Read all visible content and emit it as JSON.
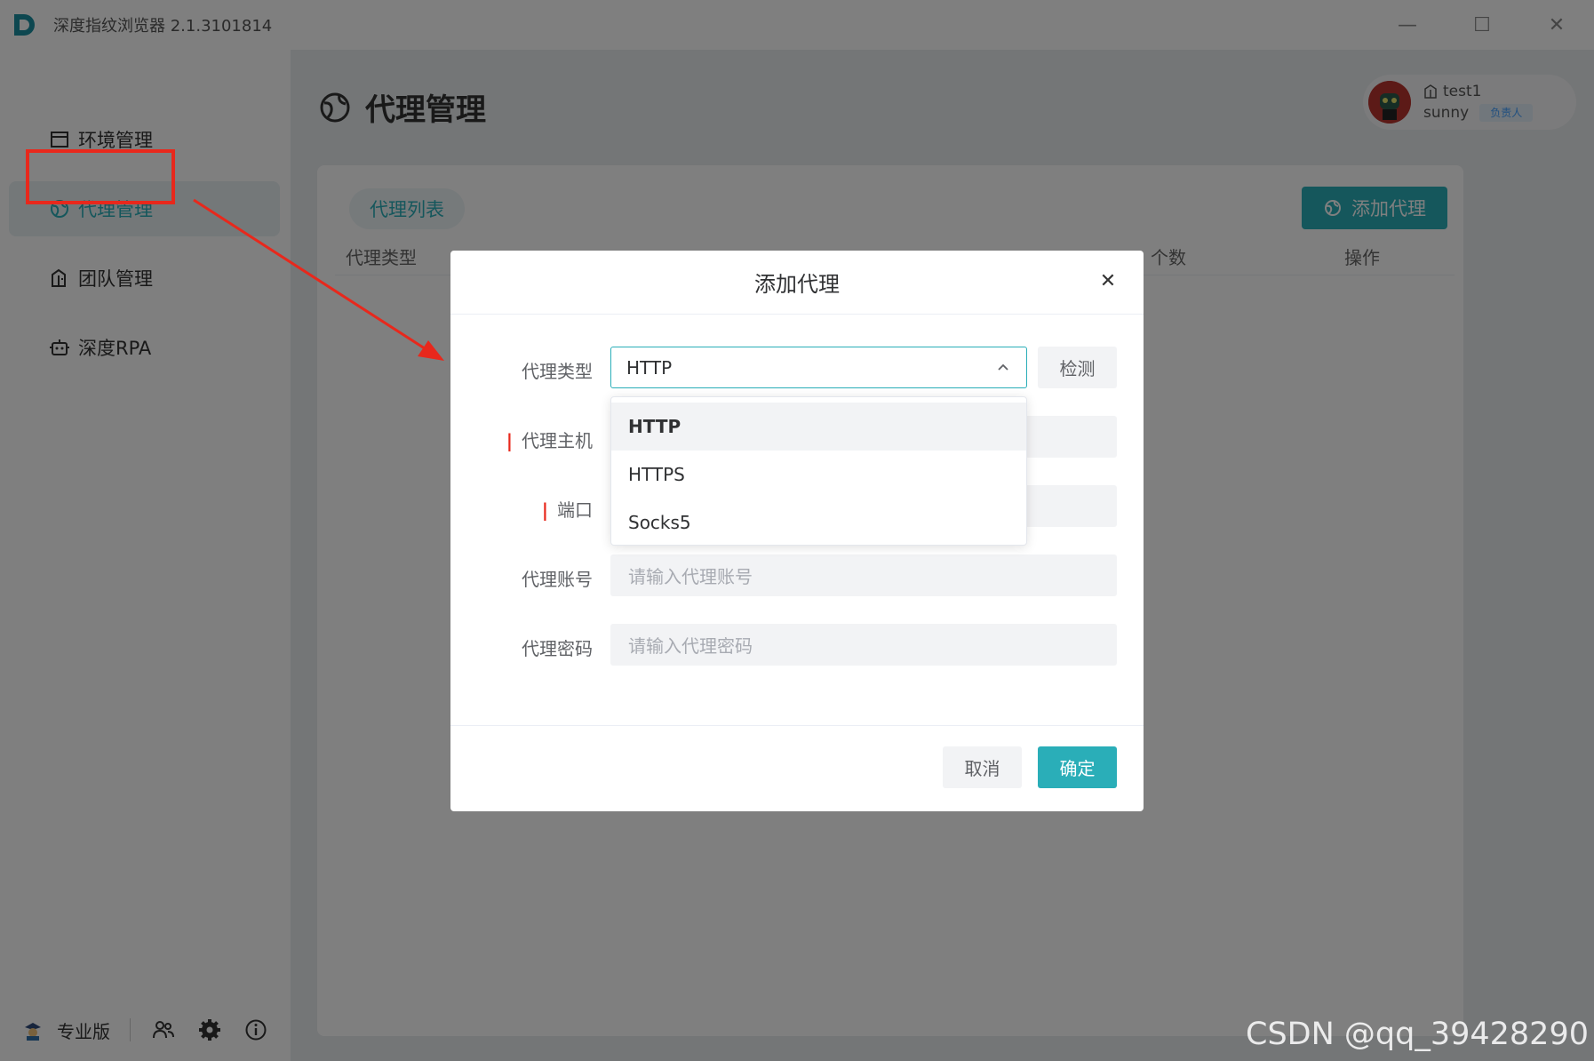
{
  "titlebar": {
    "app_name": "深度指纹浏览器 2.1.3101814",
    "controls": [
      "minimize-icon",
      "maximize-icon",
      "close-icon"
    ]
  },
  "sidebar": {
    "items": [
      {
        "label": "环境管理",
        "icon": "window-icon",
        "active": false
      },
      {
        "label": "代理管理",
        "icon": "globe-icon",
        "active": true
      },
      {
        "label": "团队管理",
        "icon": "team-doc-icon",
        "active": false
      },
      {
        "label": "深度RPA",
        "icon": "robot-icon",
        "active": false
      }
    ],
    "bottom": {
      "edition_label": "专业版",
      "icons": [
        "users-icon",
        "gear-icon",
        "info-icon"
      ]
    }
  },
  "header": {
    "title": "代理管理"
  },
  "user": {
    "name": "test1",
    "sub": "sunny",
    "role": "负责人"
  },
  "content": {
    "tab_label": "代理列表",
    "add_button_label": "添加代理",
    "columns": {
      "type": "代理类型",
      "count": "个数",
      "ops": "操作"
    }
  },
  "dialog": {
    "title": "添加代理",
    "fields": {
      "type": {
        "label": "代理类型",
        "value": "HTTP"
      },
      "host": {
        "label": "代理主机",
        "placeholder": ""
      },
      "port": {
        "label": "端口",
        "placeholder": ""
      },
      "account": {
        "label": "代理账号",
        "placeholder": "请输入代理账号"
      },
      "password": {
        "label": "代理密码",
        "placeholder": "请输入代理密码"
      }
    },
    "check_label": "检测",
    "options": [
      "HTTP",
      "HTTPS",
      "Socks5"
    ],
    "cancel_label": "取消",
    "confirm_label": "确定"
  },
  "watermark": "CSDN @qq_39428290",
  "colors": {
    "accent": "#2aaeb8",
    "annotation_red": "#e8281c"
  }
}
